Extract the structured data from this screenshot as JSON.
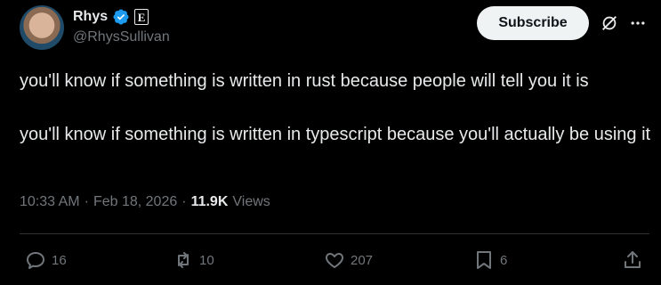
{
  "author": {
    "name": "Rhys",
    "handle": "@RhysSullivan",
    "affiliate_badge": "E"
  },
  "header": {
    "subscribe_label": "Subscribe"
  },
  "tweet": {
    "text": "you'll know if something is written in rust because people will tell you it is\n\nyou'll know if something is written in typescript because you'll actually be using it",
    "time": "10:33 AM",
    "date": "Feb 18, 2026",
    "separator": "·",
    "views_count": "11.9K",
    "views_label": "Views"
  },
  "actions": {
    "replies": "16",
    "reposts": "10",
    "likes": "207",
    "bookmarks": "6"
  },
  "colors": {
    "background": "#000000",
    "text": "#e7e9ea",
    "muted": "#71767b",
    "verified": "#1d9bf0",
    "divider": "#2f3336"
  },
  "icons": [
    "verified-badge-icon",
    "grok-icon",
    "more-icon",
    "reply-icon",
    "repost-icon",
    "like-icon",
    "bookmark-icon",
    "share-icon"
  ]
}
